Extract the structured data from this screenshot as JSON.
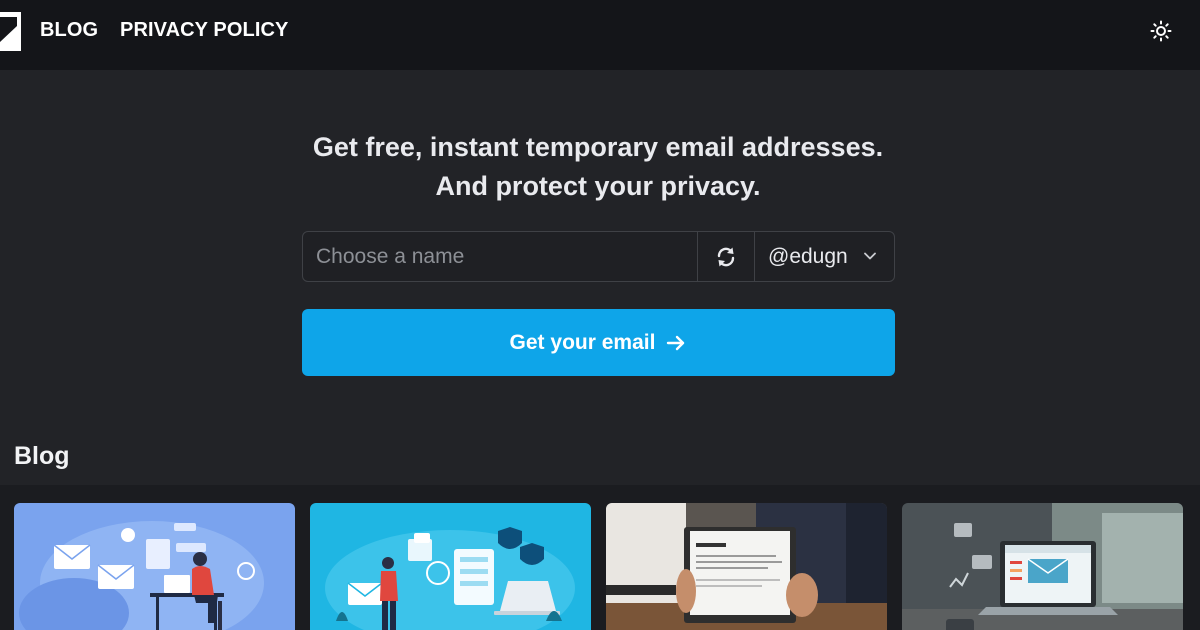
{
  "nav": {
    "blog_label": "BLOG",
    "privacy_label": "PRIVACY POLICY",
    "theme_icon": "sun-icon"
  },
  "hero": {
    "line1": "Get free, instant temporary email addresses.",
    "line2": "And protect your privacy."
  },
  "email_form": {
    "name_placeholder": "Choose a name",
    "name_value": "",
    "refresh_icon": "refresh-icon",
    "domain_selected": "@edugn",
    "cta_label": "Get your email",
    "cta_icon": "arrow-right-icon"
  },
  "blog": {
    "heading": "Blog",
    "cards": [
      {
        "image": "illustration-person-at-laptop-with-email-icons"
      },
      {
        "image": "illustration-woman-with-laptop-security-shields"
      },
      {
        "image": "photo-hands-holding-laptop-with-temp-mail"
      },
      {
        "image": "photo-laptop-on-desk-with-email-icons"
      }
    ]
  },
  "colors": {
    "page_background": "#222327",
    "topbar_background": "#141519",
    "accent": "#0ea5e9",
    "text": "#f2f3f5",
    "placeholder": "#8d9096"
  }
}
